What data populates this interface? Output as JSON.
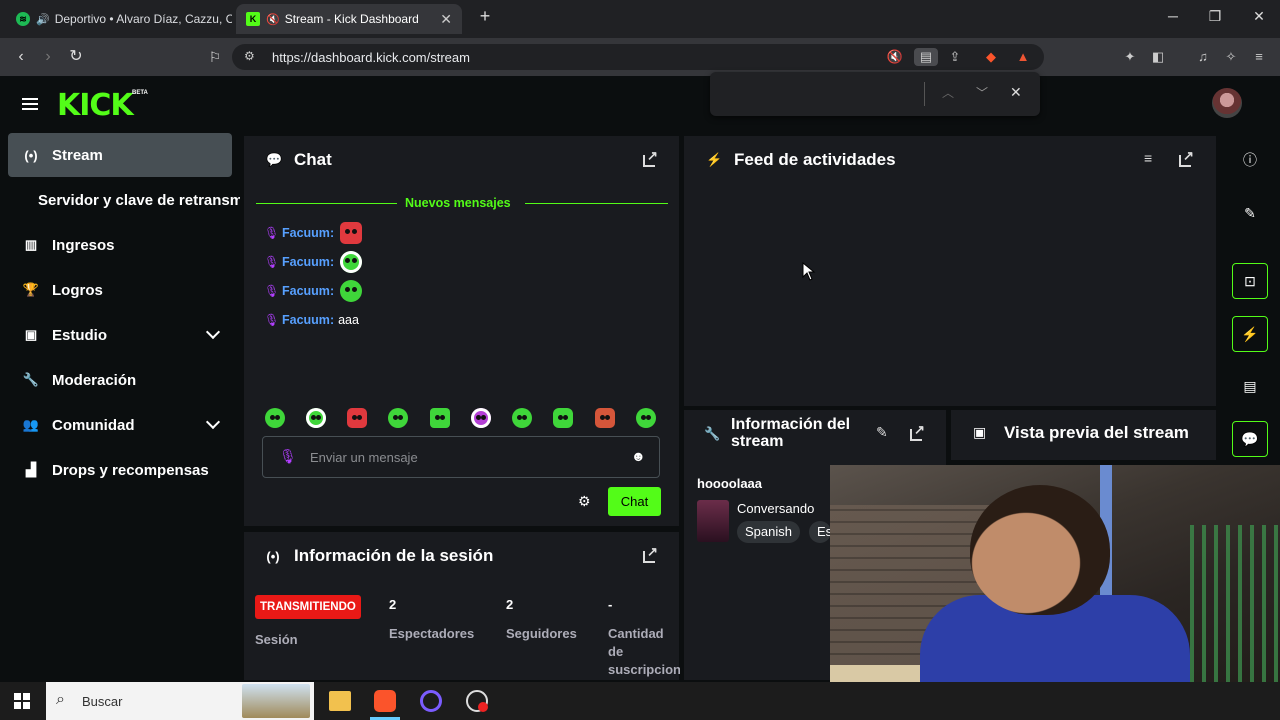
{
  "browser": {
    "tabs": [
      {
        "title": "Deportivo • Alvaro Díaz, Cazzu, C",
        "active": false
      },
      {
        "title": "Stream - Kick Dashboard",
        "active": true
      }
    ],
    "url": "https://dashboard.kick.com/stream",
    "notification_count": "1"
  },
  "app": {
    "logo": "KICK",
    "beta": "BETA"
  },
  "sidebar": {
    "items": [
      {
        "label": "Stream",
        "active": true
      },
      {
        "label": "Servidor y clave de retransmisión"
      },
      {
        "label": "Ingresos"
      },
      {
        "label": "Logros"
      },
      {
        "label": "Estudio",
        "expandable": true
      },
      {
        "label": "Moderación"
      },
      {
        "label": "Comunidad",
        "expandable": true
      },
      {
        "label": "Drops y recompensas"
      }
    ]
  },
  "chat": {
    "title": "Chat",
    "divider_label": "Nuevos mensajes",
    "messages": [
      {
        "user": "Facuum",
        "text": "",
        "emote": "red-angry"
      },
      {
        "user": "Facuum",
        "text": "",
        "emote": "green-headphones"
      },
      {
        "user": "Facuum",
        "text": "",
        "emote": "green-smile"
      },
      {
        "user": "Facuum",
        "text": "aaa"
      }
    ],
    "input_placeholder": "Enviar un mensaje",
    "send_label": "Chat"
  },
  "feed": {
    "title": "Feed de actividades"
  },
  "session": {
    "title": "Información de la sesión",
    "status_badge": "TRANSMITIENDO",
    "status_label": "Sesión",
    "stats": [
      {
        "value": "2",
        "label": "Espectadores"
      },
      {
        "value": "2",
        "label": "Seguidores"
      },
      {
        "value": "-",
        "label": "Cantidad de suscripciones"
      }
    ]
  },
  "stream_info": {
    "title": "Información del stream",
    "stream_title": "hoooolaaa",
    "category": "Conversando",
    "tags": [
      "Spanish",
      "Es"
    ]
  },
  "preview": {
    "title": "Vista previa del stream"
  },
  "taskbar": {
    "search_placeholder": "Buscar"
  },
  "colors": {
    "brand": "#53fc18",
    "live": "#e91916",
    "username": "#57a0ff",
    "panel": "#191b1f"
  }
}
